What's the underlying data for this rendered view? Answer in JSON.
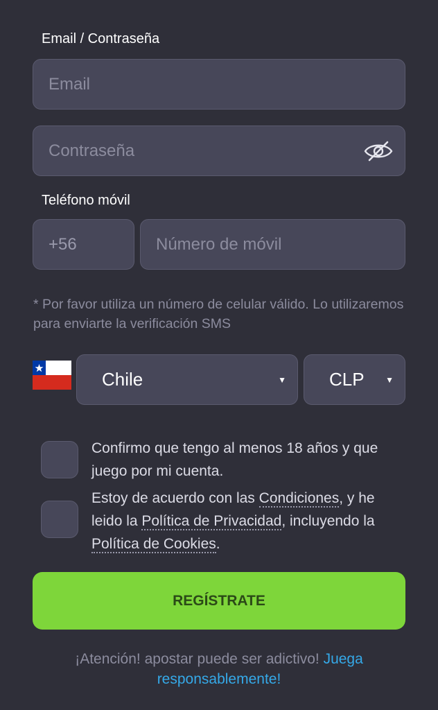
{
  "form": {
    "email_section_label": "Email / Contraseña",
    "email_placeholder": "Email",
    "password_placeholder": "Contraseña",
    "phone_section_label": "Teléfono móvil",
    "phone_prefix": "+56",
    "phone_placeholder": "Número de móvil",
    "phone_hint": "* Por favor utiliza un número de celular válido. Lo utilizaremos para enviarte la verificación SMS",
    "country": "Chile",
    "currency": "CLP",
    "age_confirm_text": "Confirmo que tengo al menos 18 años y que juego por mi cuenta.",
    "terms": {
      "part1": "Estoy de acuerdo con las ",
      "link_conditions": "Condiciones",
      "part2": ", y he leido la ",
      "link_privacy": "Política de Privacidad",
      "part3": ", incluyendo la ",
      "link_cookies": "Política de Cookies",
      "part4": "."
    },
    "submit_label": "REGÍSTRATE",
    "warning_text": "¡Atención! apostar puede ser adictivo! ",
    "warning_link": "Juega responsablemente!"
  },
  "colors": {
    "background": "#2f2f39",
    "field": "#474759",
    "accent_green": "#7ed63a",
    "link_blue": "#35a9e8"
  },
  "icons": {
    "password_toggle": "eye-slash-icon",
    "country_flag": "chile-flag-icon",
    "dropdown": "caret-down-icon"
  }
}
